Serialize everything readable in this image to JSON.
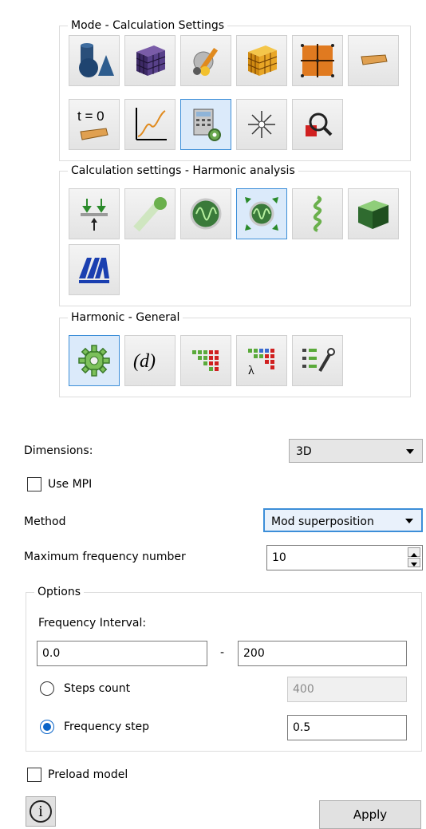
{
  "groups": {
    "mode_title": "Mode - Calculation Settings",
    "calc_title": "Calculation settings - Harmonic analysis",
    "harmonic_title": "Harmonic - General"
  },
  "icons": {
    "mode": [
      "geometry-shapes-icon",
      "mesh-cube-icon",
      "material-tool-icon",
      "mesh-grid-cube-icon",
      "orange-grid-icon",
      "beam-element-icon",
      "initial-state-icon",
      "time-chart-icon",
      "calculation-settings-icon",
      "starburst-icon",
      "inspect-magnifier-icon"
    ],
    "calc": [
      "load-arrows-icon",
      "ball-trajectory-icon",
      "harmonic-wave-icon",
      "harmonic-excitation-icon",
      "spring-icon",
      "box-element-icon",
      "apm-logo-icon"
    ],
    "harmonic": [
      "gear-icon",
      "d-parameter-icon",
      "matrix-icon",
      "lambda-matrix-icon",
      "list-settings-icon"
    ]
  },
  "t0_label": "t = 0",
  "d_label": "(d)",
  "form": {
    "dimensions_label": "Dimensions:",
    "dimensions_value": "3D",
    "use_mpi_label": "Use MPI",
    "method_label": "Method",
    "method_value": "Mod superposition",
    "max_freq_label": "Maximum frequency number",
    "max_freq_value": "10",
    "options_title": "Options",
    "freq_interval_label": "Frequency Interval:",
    "freq_from": "0.0",
    "freq_dash": "-",
    "freq_to": "200",
    "steps_count_label": "Steps count",
    "steps_count_value": "400",
    "freq_step_label": "Frequency step",
    "freq_step_value": "0.5",
    "preload_label": "Preload model",
    "info_symbol": "i",
    "apply_label": "Apply"
  },
  "colors": {
    "active_border": "#3c8ed8",
    "active_bg": "#dbeafa",
    "radio_accent": "#0a64c8"
  }
}
